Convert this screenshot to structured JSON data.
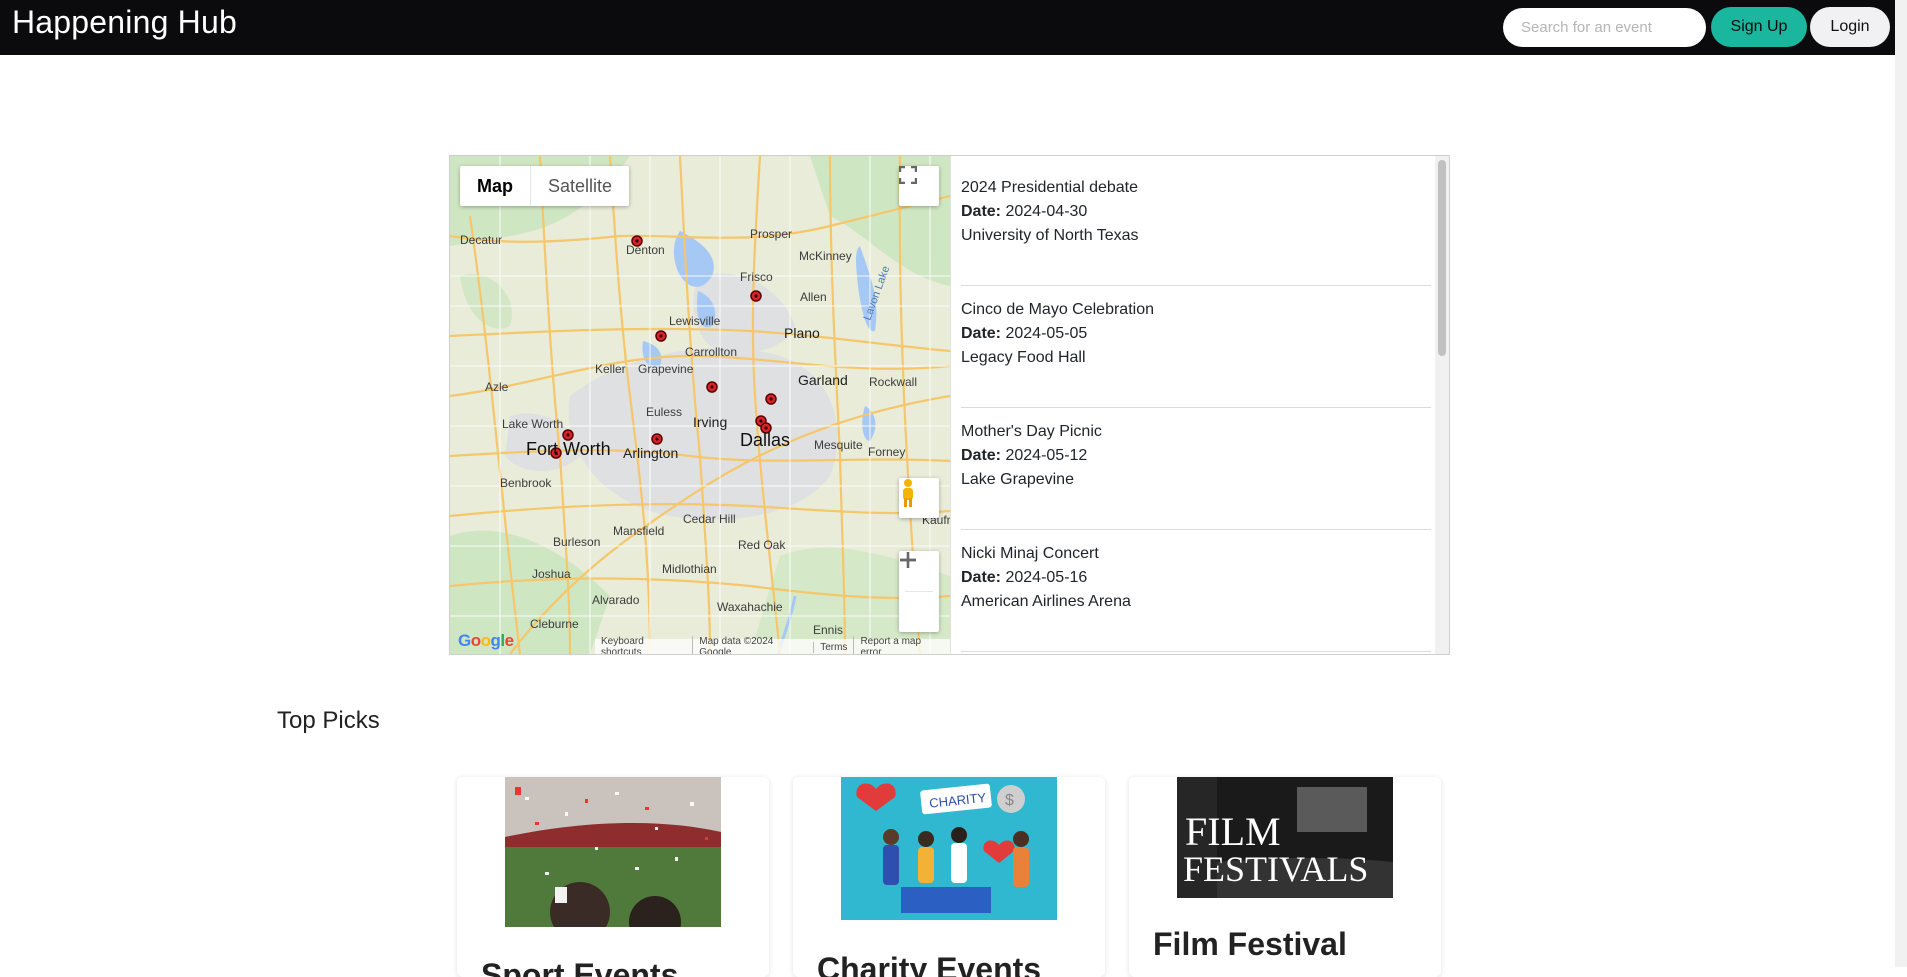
{
  "header": {
    "brand": "Happening Hub",
    "search_placeholder": "Search for an event",
    "signup_label": "Sign Up",
    "login_label": "Login"
  },
  "map": {
    "type_map": "Map",
    "type_satellite": "Satellite",
    "logo": "Google",
    "attribution": [
      "Keyboard shortcuts",
      "Map data ©2024 Google",
      "Terms",
      "Report a map error"
    ],
    "places": {
      "decatur": "Decatur",
      "denton": "Denton",
      "prosper": "Prosper",
      "mckinney": "McKinney",
      "frisco": "Frisco",
      "allen": "Allen",
      "lewisville": "Lewisville",
      "plano": "Plano",
      "carrollton": "Carrollton",
      "keller": "Keller",
      "grapevine": "Grapevine",
      "azle": "Azle",
      "garland": "Garland",
      "rockwall": "Rockwall",
      "euless": "Euless",
      "irving": "Irving",
      "lake_worth": "Lake Worth",
      "fort_worth": "Fort Worth",
      "arlington": "Arlington",
      "dallas": "Dallas",
      "mesquite": "Mesquite",
      "forney": "Forney",
      "benbrook": "Benbrook",
      "mansfield": "Mansfield",
      "cedar_hill": "Cedar Hill",
      "burleson": "Burleson",
      "red_oak": "Red Oak",
      "midlothian": "Midlothian",
      "joshua": "Joshua",
      "alvarado": "Alvarado",
      "waxahachie": "Waxahachie",
      "cleburne": "Cleburne",
      "ennis": "Ennis",
      "kaufman": "Kaufr",
      "lavon_lake": "Lavon Lake"
    }
  },
  "events": [
    {
      "name": "2024 Presidential debate",
      "date_label": "Date:",
      "date": "2024-04-30",
      "venue": "University of North Texas"
    },
    {
      "name": "Cinco de Mayo Celebration",
      "date_label": "Date:",
      "date": "2024-05-05",
      "venue": "Legacy Food Hall"
    },
    {
      "name": "Mother's Day Picnic",
      "date_label": "Date:",
      "date": "2024-05-12",
      "venue": "Lake Grapevine"
    },
    {
      "name": "Nicki Minaj Concert",
      "date_label": "Date:",
      "date": "2024-05-16",
      "venue": "American Airlines Arena"
    }
  ],
  "top_picks": {
    "title": "Top Picks",
    "cards": [
      {
        "title": "Sport Events"
      },
      {
        "title": "Charity Events",
        "image_text": "CHARITY"
      },
      {
        "title": "Film Festival",
        "image_text_1": "FILM",
        "image_text_2": "FESTIVALS"
      }
    ]
  }
}
